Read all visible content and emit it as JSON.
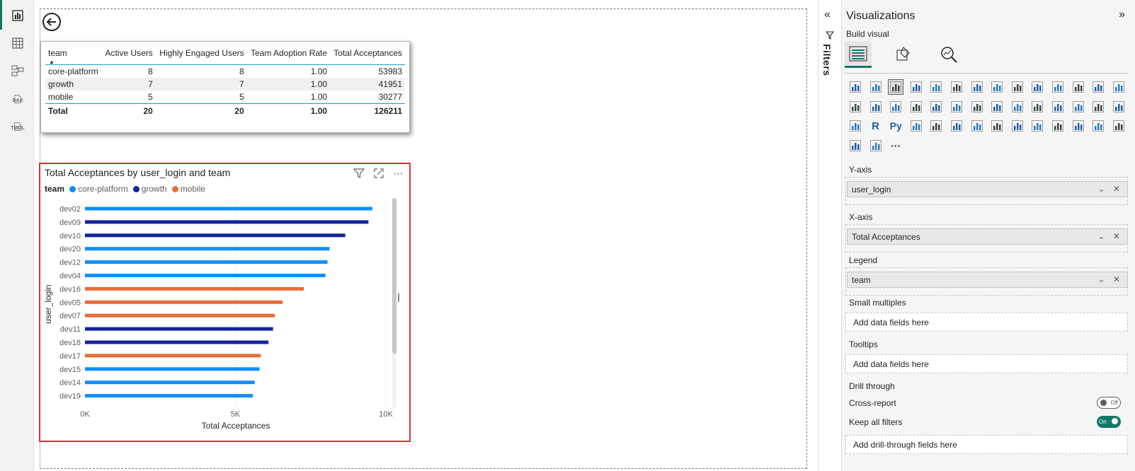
{
  "left_rail": {
    "items": [
      "report-view",
      "table-view",
      "model-view",
      "dax-query-view",
      "tmdl-view"
    ],
    "dax_label": "DAX",
    "tmdl_label": "TMDL"
  },
  "table": {
    "headers": [
      "team",
      "Active Users",
      "Highly Engaged Users",
      "Team Adoption Rate",
      "Total Acceptances"
    ],
    "rows": [
      [
        "core-platform",
        "8",
        "8",
        "1.00",
        "53983"
      ],
      [
        "growth",
        "7",
        "7",
        "1.00",
        "41951"
      ],
      [
        "mobile",
        "5",
        "5",
        "1.00",
        "30277"
      ]
    ],
    "total": [
      "Total",
      "20",
      "20",
      "1.00",
      "126211"
    ]
  },
  "chart": {
    "title": "Total Acceptances by user_login and team",
    "legend_title": "team",
    "legend": [
      {
        "name": "core-platform",
        "color": "#118dff"
      },
      {
        "name": "growth",
        "color": "#12239e"
      },
      {
        "name": "mobile",
        "color": "#e66c37"
      }
    ]
  },
  "chart_data": {
    "type": "bar",
    "orientation": "horizontal",
    "title": "Total Acceptances by user_login and team",
    "xlabel": "Total Acceptances",
    "ylabel": "user_login",
    "xlim": [
      0,
      10000
    ],
    "x_ticks": [
      "0K",
      "5K",
      "10K"
    ],
    "categories": [
      "dev02",
      "dev09",
      "dev10",
      "dev20",
      "dev12",
      "dev04",
      "dev16",
      "dev05",
      "dev07",
      "dev11",
      "dev18",
      "dev17",
      "dev15",
      "dev14",
      "dev19"
    ],
    "values": [
      9550,
      9420,
      8650,
      8130,
      8060,
      7990,
      7270,
      6570,
      6310,
      6250,
      6100,
      5840,
      5800,
      5640,
      5580
    ],
    "teams": [
      "core-platform",
      "growth",
      "growth",
      "core-platform",
      "core-platform",
      "core-platform",
      "mobile",
      "mobile",
      "mobile",
      "growth",
      "growth",
      "mobile",
      "core-platform",
      "core-platform",
      "core-platform"
    ],
    "legend_placement": "top-left",
    "grid": true
  },
  "filters": {
    "label": "Filters"
  },
  "viz_pane": {
    "title": "Visualizations",
    "build_label": "Build visual",
    "wells": {
      "y_axis_label": "Y-axis",
      "y_axis_field": "user_login",
      "x_axis_label": "X-axis",
      "x_axis_field": "Total Acceptances",
      "legend_label": "Legend",
      "legend_field": "team",
      "small_multiples_label": "Small multiples",
      "small_multiples_placeholder": "Add data fields here",
      "tooltips_label": "Tooltips",
      "tooltips_placeholder": "Add data fields here",
      "drill_through_label": "Drill through",
      "cross_report_label": "Cross-report",
      "cross_report_state": "Off",
      "keep_filters_label": "Keep all filters",
      "keep_filters_state": "On",
      "drill_placeholder": "Add drill-through fields here"
    },
    "extra_icon": "…"
  }
}
